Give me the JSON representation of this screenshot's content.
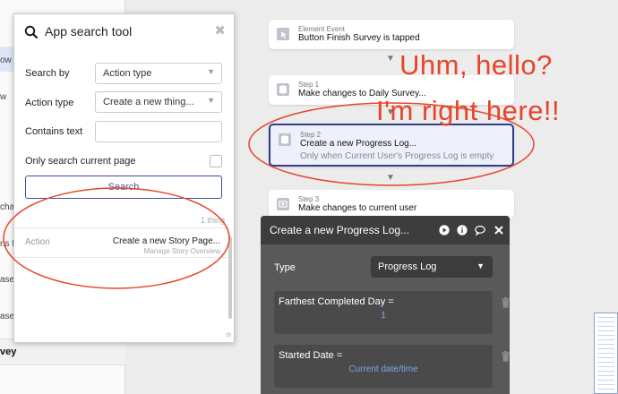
{
  "sidebar": {
    "items": [
      "ow",
      "w",
      "cha",
      "ns f",
      "ase",
      "ase"
    ],
    "bottom_item": "vey"
  },
  "search_panel": {
    "title": "App search tool",
    "search_by_label": "Search by",
    "search_by_value": "Action type",
    "action_type_label": "Action type",
    "action_type_value": "Create a new thing...",
    "contains_text_label": "Contains text",
    "contains_text_value": "",
    "only_current_page_label": "Only search current page",
    "search_button": "Search",
    "result_count": "1 thing",
    "result": {
      "type": "Action",
      "name": "Create a new Story Page...",
      "location": "Manage Story Overview"
    }
  },
  "workflow": {
    "event": {
      "kicker": "Element Event",
      "title": "Button Finish Survey is tapped"
    },
    "steps": [
      {
        "kicker": "Step 1",
        "title": "Make changes to Daily Survey..."
      },
      {
        "kicker": "Step 2",
        "title": "Create a new Progress Log...",
        "condition": "Only when Current User's Progress Log is empty"
      },
      {
        "kicker": "Step 3",
        "title": "Make changes to current user"
      }
    ]
  },
  "annotation": {
    "line1": "Uhm, hello?",
    "line2": "I'm right here!!"
  },
  "properties": {
    "title": "Create a new Progress Log...",
    "type_label": "Type",
    "type_value": "Progress Log",
    "fields": [
      {
        "label": "Farthest Completed Day =",
        "value": "1"
      },
      {
        "label": "Started Date =",
        "value": "Current date/time"
      }
    ]
  },
  "colors": {
    "accent": "#2f3e8a",
    "annotation": "#e7452a",
    "panel_dark": "#3d3d3d",
    "dynamic_value": "#7fa8e8"
  }
}
